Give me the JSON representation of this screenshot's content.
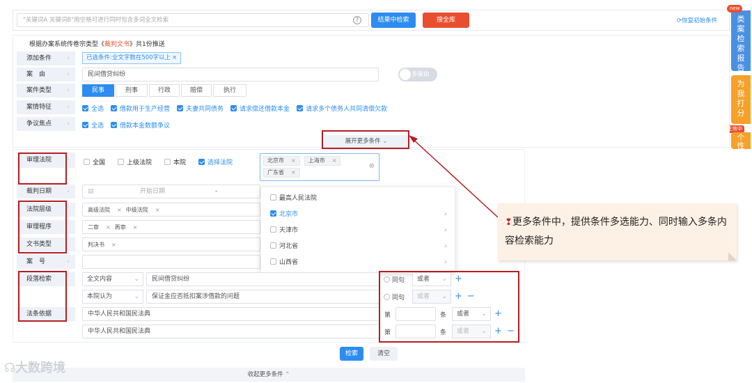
{
  "search": {
    "placeholder": "\"关键词A 关键词B\"用空格可进行同时包含多词全文检索",
    "help_glyph": "?",
    "in_result_btn": "结果中检索",
    "all_lib_btn": "搜全库",
    "restore": "恢复初始条件"
  },
  "side": {
    "new_badge": "new",
    "report_tab": "类案检索报告",
    "help_tab": "为我打分",
    "active_badge": "生效中",
    "personal_tab": "个性"
  },
  "summary": {
    "prefix": "根据办案系统传卷宗类型《",
    "doc_type": "裁判文书",
    "suffix": "》共1份推送"
  },
  "rows": {
    "add_condition": {
      "label": "添加条件",
      "tag": "已选条件:全文字数在500字以上",
      "tag_close": "×"
    },
    "cause": {
      "label": "案　由",
      "value": "民间借贷纠纷",
      "toggle": "多案由"
    },
    "case_type": {
      "label": "案件类型",
      "options": [
        "民事",
        "刑事",
        "行政",
        "赔偿",
        "执行"
      ],
      "selected": "民事"
    },
    "features": {
      "label": "案情特征",
      "items": [
        "全选",
        "借款用于生产经营",
        "夫妻共同债务",
        "请求偿还借款本金",
        "请求多个债务人共同清偿欠款"
      ]
    },
    "disputes": {
      "label": "争议焦点",
      "items": [
        "全选",
        "借款本金数额争议"
      ]
    }
  },
  "expand_more": "展开更多条件",
  "expand_chevron": "⌄",
  "court": {
    "label": "审理法院",
    "options": [
      "全国",
      "上级法院",
      "本院",
      "选择法院"
    ],
    "selected_tags": [
      "北京市",
      "上海市",
      "广东省"
    ],
    "clear_glyph": "⊗",
    "dropdown": [
      {
        "name": "最高人民法院",
        "checked": false,
        "arrow": false
      },
      {
        "name": "北京市",
        "checked": true,
        "arrow": true
      },
      {
        "name": "天津市",
        "checked": false,
        "arrow": true
      },
      {
        "name": "河北省",
        "checked": false,
        "arrow": true
      },
      {
        "name": "山西省",
        "checked": false,
        "arrow": true
      }
    ]
  },
  "judge_date": {
    "label": "裁判日期",
    "start_placeholder": "开始日期",
    "sep": "-"
  },
  "court_level": {
    "label": "法院层级",
    "tags": [
      "高级法院",
      "中级法院"
    ]
  },
  "procedure": {
    "label": "审理程序",
    "tags": [
      "二审",
      "再审"
    ]
  },
  "doc_kind": {
    "label": "文书类型",
    "tags": [
      "判决书"
    ]
  },
  "case_no": {
    "label": "案　号"
  },
  "paragraph": {
    "label": "段落检索",
    "rows": [
      {
        "scope": "全文内容",
        "text": "民间借贷纠纷",
        "same": "同句",
        "logic": "或者"
      },
      {
        "scope": "本院认为",
        "text": "保证金应否抵扣案涉借款的问题",
        "same": "同句",
        "logic": "或者"
      }
    ]
  },
  "law": {
    "label": "法条依据",
    "rows": [
      {
        "text": "中华人民共和国民法典",
        "di": "第",
        "tiao": "条",
        "logic": "或者"
      },
      {
        "text": "中华人民共和国民法典",
        "di": "第",
        "tiao": "条",
        "logic": "或者"
      }
    ]
  },
  "actions": {
    "search": "检索",
    "clear": "清空",
    "collapse": "收起更多条件",
    "collapse_chevron": "⌃"
  },
  "callout": {
    "pin": "❢",
    "text": "更多条件中，提供条件多选能力、同时输入多条内容检索能力"
  },
  "watermark": "大数跨境",
  "colors": {
    "accent": "#2d8cf0",
    "danger": "#e94f2e",
    "annotation": "#b71c22",
    "callout_bg": "#fdf1e6"
  }
}
